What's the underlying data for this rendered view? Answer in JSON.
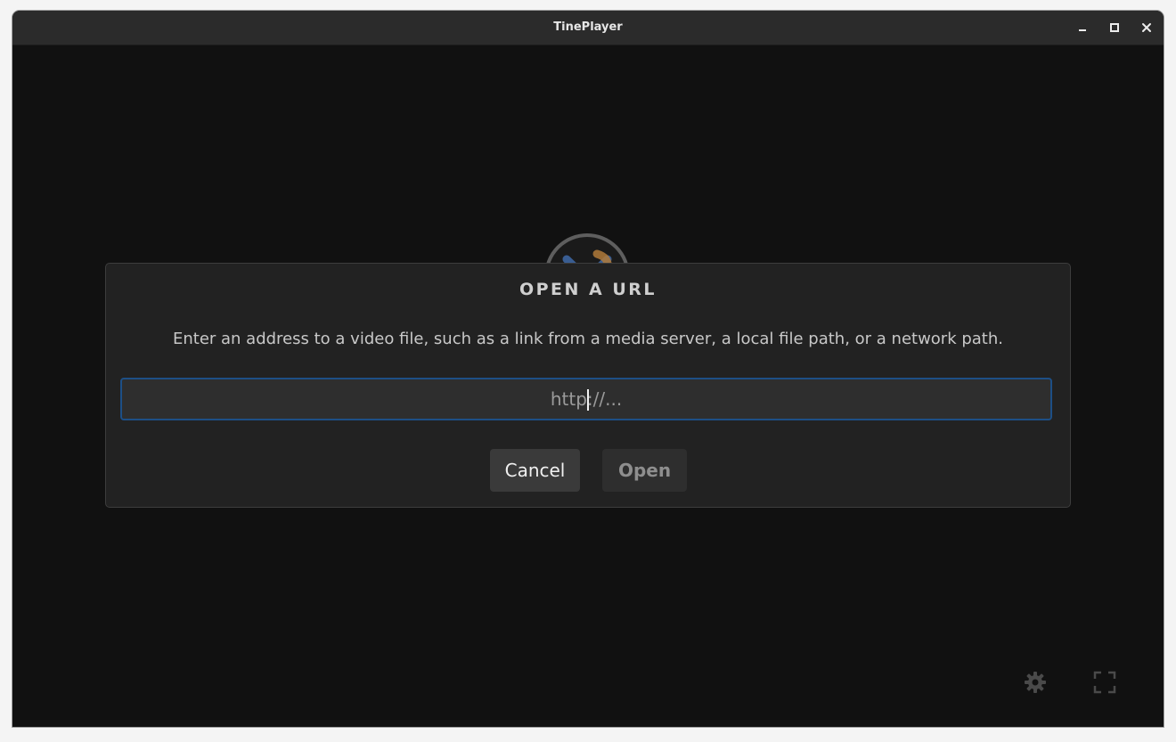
{
  "window": {
    "title": "TinePlayer",
    "controls": {
      "minimize_icon": "minimize-icon",
      "maximize_icon": "maximize-icon",
      "close_icon": "close-icon"
    }
  },
  "dialog": {
    "title": "OPEN A URL",
    "description": "Enter an address to a video file, such as a link from a media server, a local file path, or a network path.",
    "input": {
      "value": "",
      "placeholder": "http://..."
    },
    "cancel_label": "Cancel",
    "open_label": "Open"
  },
  "footer_controls": {
    "settings_icon": "gear-icon",
    "fullscreen_icon": "fullscreen-icon"
  },
  "colors": {
    "window_bg": "#111111",
    "titlebar_bg": "#2b2b2b",
    "dialog_bg": "#222222",
    "input_border_focus": "#1d4f86"
  }
}
